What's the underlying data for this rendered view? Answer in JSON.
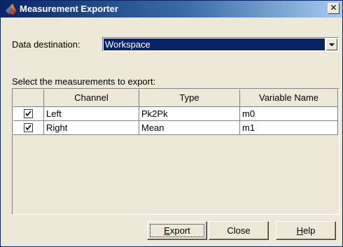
{
  "window": {
    "title": "Measurement Exporter",
    "close_glyph": "✕",
    "icon": "matlab-logo-icon"
  },
  "destination": {
    "label": "Data destination:",
    "value": "Workspace"
  },
  "measurements": {
    "label": "Select the measurements to export:",
    "columns": [
      "",
      "Channel",
      "Type",
      "Variable Name"
    ],
    "rows": [
      {
        "checked": true,
        "channel": "Left",
        "type": "Pk2Pk",
        "variable": "m0"
      },
      {
        "checked": true,
        "channel": "Right",
        "type": "Mean",
        "variable": "m1"
      }
    ]
  },
  "buttons": {
    "export_mnemonic": "E",
    "export_rest": "xport",
    "close": "Close",
    "help_mnemonic": "H",
    "help_rest": "elp"
  },
  "colors": {
    "titlebar_start": "#0a246a",
    "titlebar_end": "#a6caf0",
    "selection": "#0a246a",
    "face": "#ece9d8"
  }
}
